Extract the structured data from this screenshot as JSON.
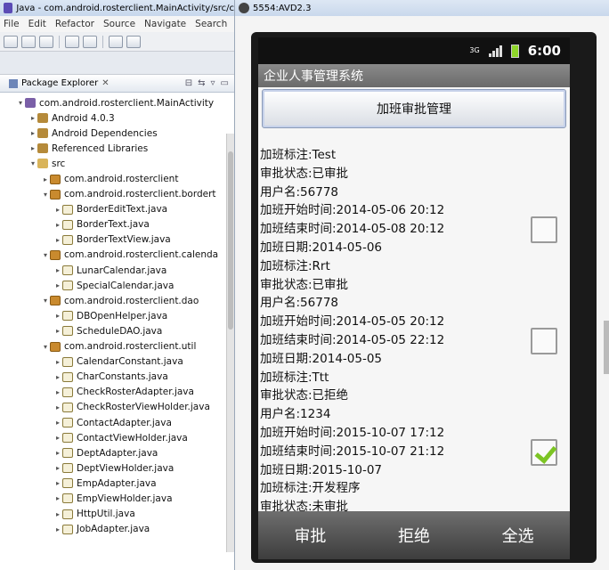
{
  "eclipse": {
    "title": "Java - com.android.rosterclient.MainActivity/src/c",
    "menu": [
      "File",
      "Edit",
      "Refactor",
      "Source",
      "Navigate",
      "Search"
    ],
    "panel_title": "Package Explorer",
    "tree": [
      {
        "label": "com.android.rosterclient.MainActivity",
        "depth": 1,
        "icon": "project",
        "arrow": "▾"
      },
      {
        "label": "Android 4.0.3",
        "depth": 2,
        "icon": "lib",
        "arrow": "▸"
      },
      {
        "label": "Android Dependencies",
        "depth": 2,
        "icon": "lib",
        "arrow": "▸"
      },
      {
        "label": "Referenced Libraries",
        "depth": 2,
        "icon": "lib",
        "arrow": "▸"
      },
      {
        "label": "src",
        "depth": 2,
        "icon": "folder",
        "arrow": "▾"
      },
      {
        "label": "com.android.rosterclient",
        "depth": 3,
        "icon": "pkg",
        "arrow": "▸"
      },
      {
        "label": "com.android.rosterclient.bordert",
        "depth": 3,
        "icon": "pkg",
        "arrow": "▾"
      },
      {
        "label": "BorderEditText.java",
        "depth": 4,
        "icon": "java",
        "arrow": "▸"
      },
      {
        "label": "BorderText.java",
        "depth": 4,
        "icon": "java",
        "arrow": "▸"
      },
      {
        "label": "BorderTextView.java",
        "depth": 4,
        "icon": "java",
        "arrow": "▸"
      },
      {
        "label": "com.android.rosterclient.calenda",
        "depth": 3,
        "icon": "pkg",
        "arrow": "▾"
      },
      {
        "label": "LunarCalendar.java",
        "depth": 4,
        "icon": "java",
        "arrow": "▸"
      },
      {
        "label": "SpecialCalendar.java",
        "depth": 4,
        "icon": "java",
        "arrow": "▸"
      },
      {
        "label": "com.android.rosterclient.dao",
        "depth": 3,
        "icon": "pkg",
        "arrow": "▾"
      },
      {
        "label": "DBOpenHelper.java",
        "depth": 4,
        "icon": "java",
        "arrow": "▸"
      },
      {
        "label": "ScheduleDAO.java",
        "depth": 4,
        "icon": "java",
        "arrow": "▸"
      },
      {
        "label": "com.android.rosterclient.util",
        "depth": 3,
        "icon": "pkg",
        "arrow": "▾"
      },
      {
        "label": "CalendarConstant.java",
        "depth": 4,
        "icon": "java",
        "arrow": "▸"
      },
      {
        "label": "CharConstants.java",
        "depth": 4,
        "icon": "java",
        "arrow": "▸"
      },
      {
        "label": "CheckRosterAdapter.java",
        "depth": 4,
        "icon": "java",
        "arrow": "▸"
      },
      {
        "label": "CheckRosterViewHolder.java",
        "depth": 4,
        "icon": "java",
        "arrow": "▸"
      },
      {
        "label": "ContactAdapter.java",
        "depth": 4,
        "icon": "java",
        "arrow": "▸"
      },
      {
        "label": "ContactViewHolder.java",
        "depth": 4,
        "icon": "java",
        "arrow": "▸"
      },
      {
        "label": "DeptAdapter.java",
        "depth": 4,
        "icon": "java",
        "arrow": "▸"
      },
      {
        "label": "DeptViewHolder.java",
        "depth": 4,
        "icon": "java",
        "arrow": "▸"
      },
      {
        "label": "EmpAdapter.java",
        "depth": 4,
        "icon": "java",
        "arrow": "▸"
      },
      {
        "label": "EmpViewHolder.java",
        "depth": 4,
        "icon": "java",
        "arrow": "▸"
      },
      {
        "label": "HttpUtil.java",
        "depth": 4,
        "icon": "java",
        "arrow": "▸"
      },
      {
        "label": "JobAdapter.java",
        "depth": 4,
        "icon": "java",
        "arrow": "▸"
      }
    ]
  },
  "emulator": {
    "title": "5554:AVD2.3",
    "status": {
      "network": "3G",
      "time": "6:00"
    },
    "app_title": "企业人事管理系统",
    "primary_button": "加班审批管理",
    "records": [
      {
        "lines": [
          "加班标注:Test",
          "审批状态:已审批",
          "用户名:56778",
          "加班开始时间:2014-05-06  20:12",
          "加班结束时间:2014-05-08  20:12",
          "加班日期:2014-05-06"
        ],
        "checked": false
      },
      {
        "lines": [
          "加班标注:Rrt",
          "审批状态:已审批",
          "用户名:56778",
          "加班开始时间:2014-05-05  20:12",
          "加班结束时间:2014-05-05  22:12",
          "加班日期:2014-05-05"
        ],
        "checked": false
      },
      {
        "lines": [
          "加班标注:Ttt",
          "审批状态:已拒绝",
          "用户名:1234",
          "加班开始时间:2015-10-07  17:12",
          "加班结束时间:2015-10-07  21:12",
          "加班日期:2015-10-07"
        ],
        "checked": true
      },
      {
        "lines": [
          "加班标注:开发程序",
          "审批状态:未审批"
        ],
        "checked": false,
        "partial": true
      }
    ],
    "actions": [
      "审批",
      "拒绝",
      "全选"
    ]
  },
  "colors": {
    "check_green": "#7cc424",
    "battery_green": "#8fd62a",
    "bottom_bar": "#4a4a4a"
  }
}
